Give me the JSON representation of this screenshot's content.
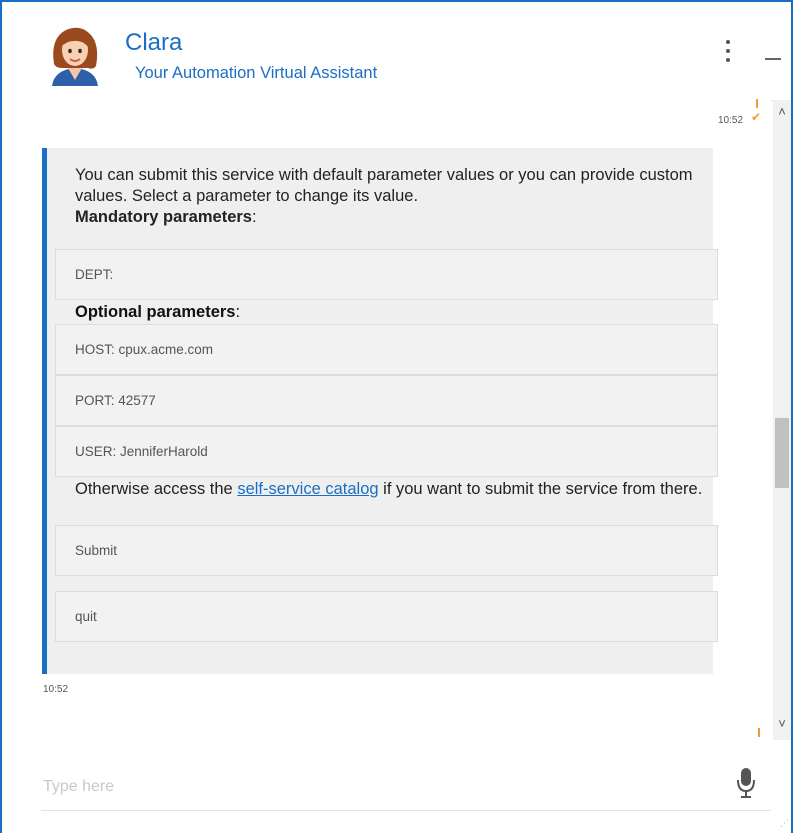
{
  "header": {
    "name": "Clara",
    "subtitle": "Your Automation Virtual Assistant"
  },
  "messages": {
    "time_top": "10:52",
    "time_bottom": "10:52",
    "intro_text": "You can submit this service with default parameter values or you can provide custom values. Select a parameter to change its value.",
    "mandatory_label": "Mandatory parameters",
    "optional_label": "Optional parameters",
    "colon": ":",
    "mandatory_params": [
      "DEPT:"
    ],
    "optional_params": [
      "HOST: cpux.acme.com",
      "PORT: 42577",
      "USER: JenniferHarold"
    ],
    "otherwise_prefix": "Otherwise access the ",
    "otherwise_link": "self-service catalog",
    "otherwise_suffix": " if you want to submit the service from there.",
    "actions": [
      "Submit",
      "quit"
    ]
  },
  "input": {
    "placeholder": "Type here",
    "value": ""
  },
  "colors": {
    "accent": "#1a6fc4",
    "orange": "#f39a34",
    "bubble_bg": "#efefef"
  },
  "icons": [
    "avatar",
    "kebab-menu-icon",
    "minimize-icon",
    "check-icon",
    "chevron-up-icon",
    "chevron-down-icon",
    "microphone-icon"
  ]
}
